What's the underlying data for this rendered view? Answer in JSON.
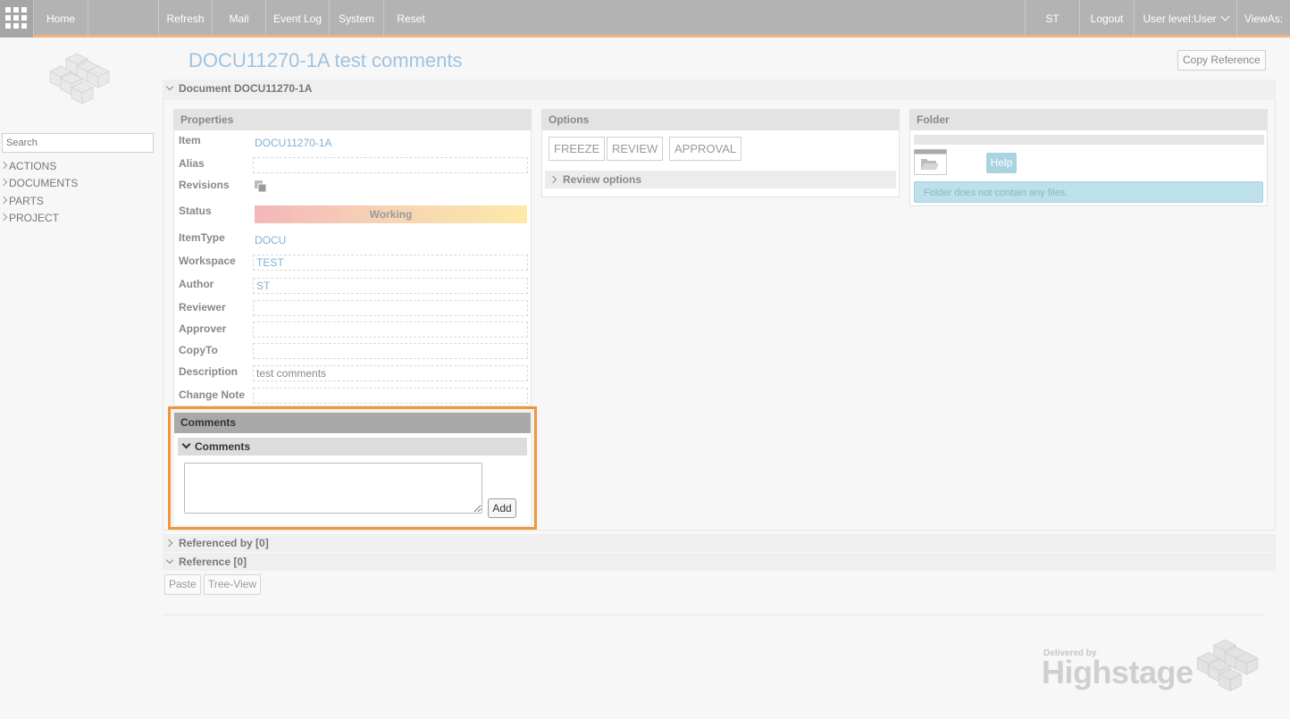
{
  "topbar": {
    "home": "Home",
    "refresh": "Refresh",
    "mail": "Mail",
    "event_log": "Event Log",
    "system": "System",
    "reset": "Reset",
    "user": "ST",
    "logout": "Logout",
    "user_level": "User level:User",
    "view_as": "ViewAs:"
  },
  "sidebar": {
    "search_placeholder": "Search",
    "items": [
      {
        "label": "ACTIONS"
      },
      {
        "label": "DOCUMENTS"
      },
      {
        "label": "PARTS"
      },
      {
        "label": "PROJECT"
      }
    ]
  },
  "page": {
    "title": "DOCU11270-1A test comments",
    "copy_reference": "Copy Reference",
    "document_section": "Document DOCU11270-1A"
  },
  "properties": {
    "header": "Properties",
    "item_label": "Item",
    "item_value": "DOCU11270-1A",
    "alias_label": "Alias",
    "alias_value": "",
    "revisions_label": "Revisions",
    "status_label": "Status",
    "status_value": "Working",
    "itemtype_label": "ItemType",
    "itemtype_value": "DOCU",
    "workspace_label": "Workspace",
    "workspace_value": "TEST",
    "author_label": "Author",
    "author_value": "ST",
    "reviewer_label": "Reviewer",
    "reviewer_value": "",
    "approver_label": "Approver",
    "approver_value": "",
    "copyto_label": "CopyTo",
    "copyto_value": "",
    "description_label": "Description",
    "description_value": "test comments",
    "changenote_label": "Change Note",
    "changenote_value": ""
  },
  "options": {
    "header": "Options",
    "freeze": "FREEZE",
    "review": "REVIEW",
    "approval": "APPROVAL",
    "review_options": "Review options"
  },
  "folder": {
    "header": "Folder",
    "help": "Help",
    "empty_message": "Folder does not contain any files."
  },
  "comments": {
    "header": "Comments",
    "sub_header": "Comments",
    "textarea_value": "",
    "add_button": "Add"
  },
  "sections": {
    "referenced_by": "Referenced by [0]",
    "reference": "Reference [0]"
  },
  "bottom_buttons": {
    "paste": "Paste",
    "tree_view": "Tree-View"
  },
  "footer": {
    "delivered_by": "Delivered by",
    "brand": "Highstage"
  },
  "colors": {
    "topbar": "#b3b3b3",
    "topbar_accent": "#f1b27c",
    "link": "#7fb0d6",
    "highlight": "#f0973a",
    "info_box": "#bde0ea"
  }
}
